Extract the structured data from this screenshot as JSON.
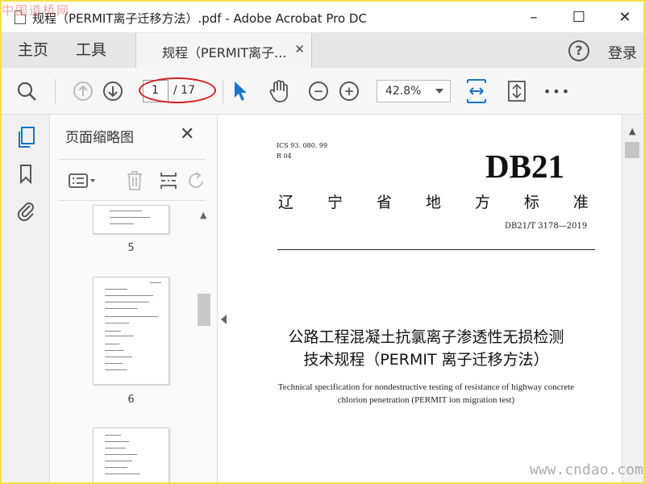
{
  "watermark_top": "中国道桥网",
  "watermark_bottom": "www.cndao.com",
  "window": {
    "title": "规程（PERMIT离子迁移方法）.pdf - Adobe Acrobat Pro DC",
    "controls": [
      "–",
      "☐",
      "✕"
    ]
  },
  "nav": {
    "home": "主页",
    "tools": "工具",
    "doc_tab": "规程（PERMIT离子...",
    "doc_tab_close": "✕",
    "help": "?",
    "login": "登录"
  },
  "toolbar": {
    "page_current": "1",
    "page_total": "/ 17",
    "zoom": "42.8%",
    "more": "•••",
    "zoom_out": "−",
    "zoom_in": "+"
  },
  "thumbnail_panel": {
    "title": "页面缩略图",
    "close": "✕",
    "pages": [
      "5",
      "6"
    ]
  },
  "document": {
    "ics": "ICS 93. 080. 99",
    "r_code": "R 04",
    "db_code": "DB21",
    "province_chars": [
      "辽",
      "宁",
      "省",
      "地",
      "方",
      "标",
      "准"
    ],
    "std_number": "DB21/T 3178—2019",
    "title_cn_line1": "公路工程混凝土抗氯离子渗透性无损检测",
    "title_cn_line2": "技术规程（PERMIT 离子迁移方法）",
    "title_en_line1": "Technical specification for nondestructive testing of resistance of highway concrete",
    "title_en_line2": "chlorion penetration (PERMIT ion migration test)"
  },
  "colors": {
    "accent_blue": "#1a73c8",
    "annotation_red": "#d21e1e",
    "frame_yellow": "#f4e04a"
  }
}
